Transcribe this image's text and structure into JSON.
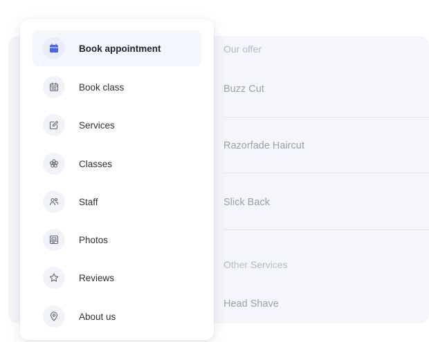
{
  "colors": {
    "accent": "#4a62e6",
    "icon_muted": "#5f6675",
    "active_bg": "#f4f6fd",
    "panel_bg": "#f4f6fb"
  },
  "menu": {
    "items": [
      {
        "label": "Book appointment",
        "icon": "calendar-icon",
        "active": true
      },
      {
        "label": "Book class",
        "icon": "calendar-grid-icon",
        "active": false
      },
      {
        "label": "Services",
        "icon": "edit-icon",
        "active": false
      },
      {
        "label": "Classes",
        "icon": "flower-icon",
        "active": false
      },
      {
        "label": "Staff",
        "icon": "people-icon",
        "active": false
      },
      {
        "label": "Photos",
        "icon": "image-icon",
        "active": false
      },
      {
        "label": "Reviews",
        "icon": "star-icon",
        "active": false
      },
      {
        "label": "About us",
        "icon": "location-pin-icon",
        "active": false
      }
    ]
  },
  "offer": {
    "heading": "Our offer",
    "items": [
      "Buzz Cut",
      "Razorfade Haircut",
      "Slick Back"
    ],
    "other_heading": "Other Services",
    "other_items": [
      "Head Shave"
    ]
  }
}
